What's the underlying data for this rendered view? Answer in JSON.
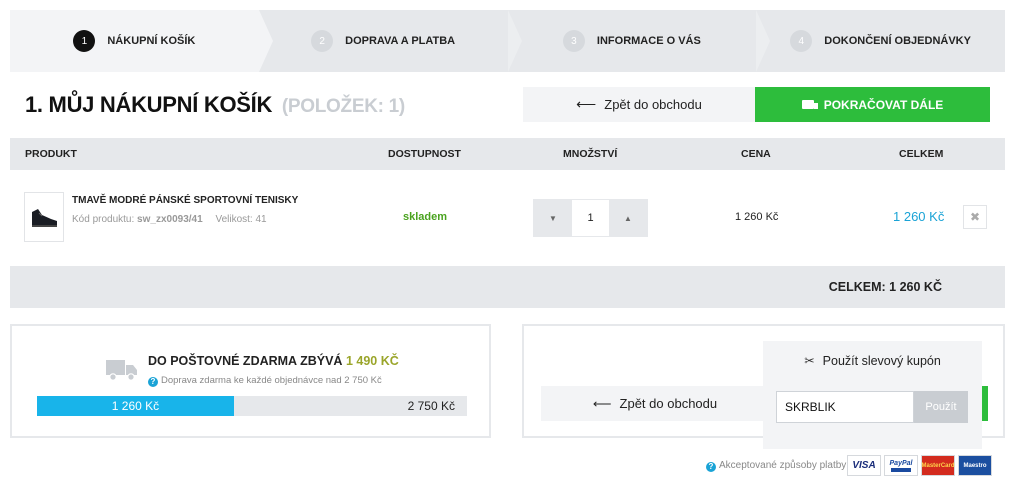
{
  "steps": [
    {
      "num": "1",
      "label": "NÁKUPNÍ KOŠÍK"
    },
    {
      "num": "2",
      "label": "DOPRAVA A PLATBA"
    },
    {
      "num": "3",
      "label": "INFORMACE O VÁS"
    },
    {
      "num": "4",
      "label": "DOKONČENÍ OBJEDNÁVKY"
    }
  ],
  "header": {
    "title": "1. MŮJ NÁKUPNÍ KOŠÍK",
    "count": "(POLOŽEK: 1)",
    "back_label": "Zpět do obchodu",
    "continue_label": "POKRAČOVAT DÁLE"
  },
  "table": {
    "columns": [
      "PRODUKT",
      "DOSTUPNOST",
      "MNOŽSTVÍ",
      "CENA",
      "CELKEM"
    ]
  },
  "item": {
    "name": "TMAVĚ MODRÉ PÁNSKÉ SPORTOVNÍ TENISKY",
    "code_label": "Kód produktu:",
    "code": "sw_zx0093/41",
    "size": "Velikost: 41",
    "availability": "skladem",
    "quantity": "1",
    "price": "1 260 Kč",
    "total": "1 260 Kč",
    "remove_icon": "close-icon"
  },
  "summary": {
    "total": "CELKEM: 1 260 KČ"
  },
  "shipping": {
    "heading": "DO POŠTOVNÉ ZDARMA ZBÝVÁ",
    "remaining": "1 490 KČ",
    "note": "Doprava zdarma ke každé objednávce nad 2 750 Kč",
    "current": "1 260 Kč",
    "threshold": "2 750 Kč",
    "progress": 0.458
  },
  "coupon": {
    "heading": "Použít slevový kupón",
    "value": "SKRBLIK",
    "apply_label": "Použít",
    "back_label": "Zpět do obchodu"
  },
  "payments": {
    "note": "Akceptované způsoby platby",
    "cards": [
      "VISA",
      "PayPal",
      "MasterCard",
      "Maestro"
    ]
  },
  "colors": {
    "accent_green": "#2dbd3c",
    "price_blue": "#1aa3d6",
    "progress_blue": "#18b4ea",
    "stock_green": "#4aa31f"
  }
}
